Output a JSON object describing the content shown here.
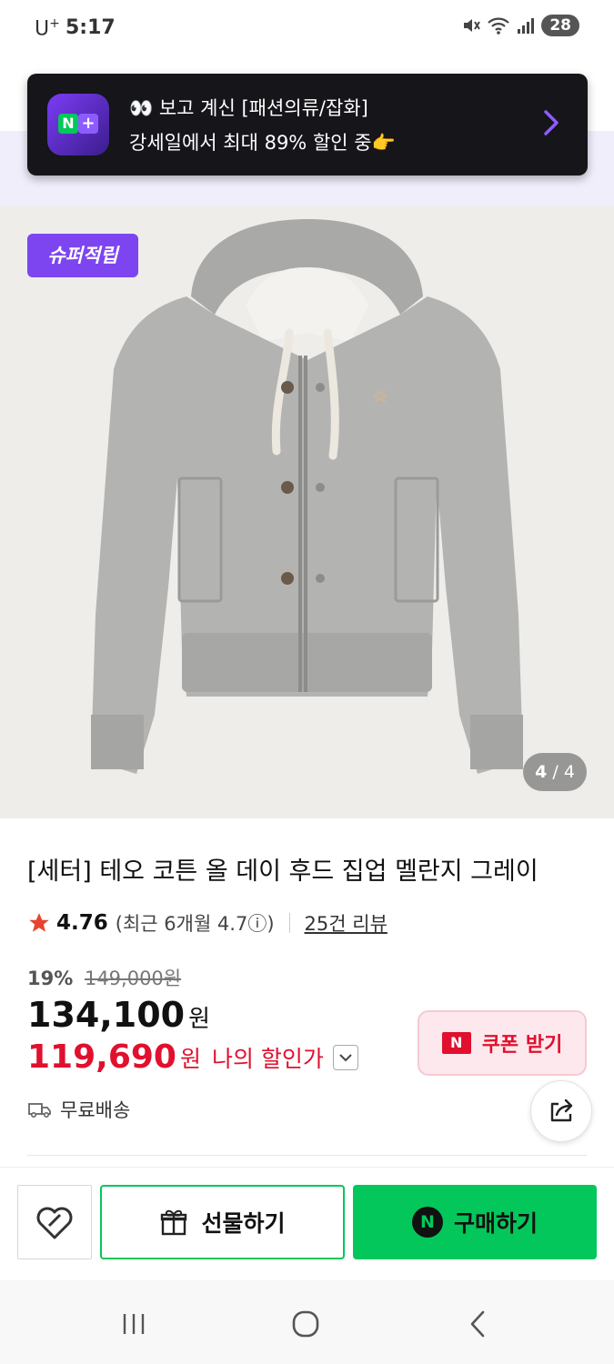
{
  "status_bar": {
    "carrier": "U",
    "carrier_sup": "+",
    "time": "5:17",
    "battery": "28"
  },
  "toast": {
    "line1": "👀 보고 계신 [패션의류/잡화]",
    "line2": "강세일에서 최대 89% 할인 중👉",
    "logo_n": "N",
    "logo_plus": "+"
  },
  "product": {
    "badge": "슈퍼적립",
    "image_counter_current": "4",
    "image_counter_total": "/ 4",
    "title": "[세터] 테오 코튼 올 데이 후드 집업 멜란지 그레이",
    "rating": "4.76",
    "rating_recent": "(최근 6개월 4.7ⓘ)",
    "review_link": "25건 리뷰",
    "discount_pct": "19%",
    "original_price": "149,000원",
    "price": "134,100",
    "price_unit": "원",
    "my_price": "119,690",
    "my_price_unit": "원",
    "my_price_label": "나의 할인가",
    "coupon_mark": "N",
    "coupon_label": "쿠폰 받기",
    "shipping": "무료배송"
  },
  "actions": {
    "gift_label": "선물하기",
    "buy_mark": "N",
    "buy_label": "구매하기"
  },
  "colors": {
    "naver_green": "#03c75a",
    "accent_purple": "#7d45f0",
    "discount_red": "#e0102e"
  }
}
